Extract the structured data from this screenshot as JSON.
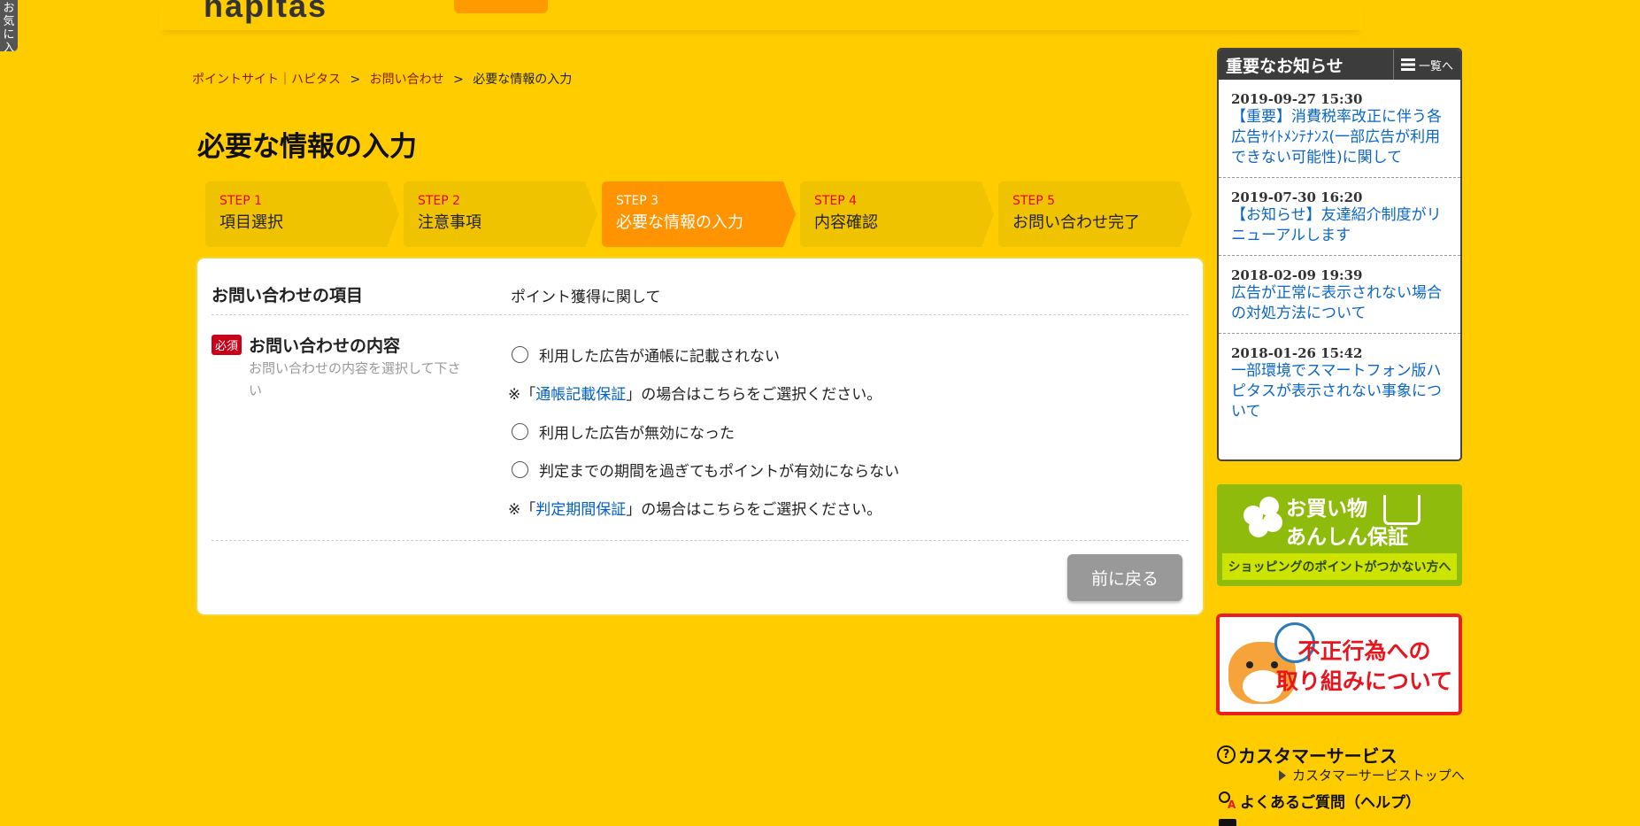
{
  "side_tab": {
    "label": "お気に入り"
  },
  "header": {
    "logo": "hapitas"
  },
  "breadcrumb": [
    {
      "label": "ポイントサイト｜ハピタス"
    },
    {
      "label": "お問い合わせ"
    },
    {
      "label": "必要な情報の入力"
    }
  ],
  "breadcrumb_sep": ">",
  "page_title": "必要な情報の入力",
  "steps": [
    {
      "num": "STEP 1",
      "label": "項目選択"
    },
    {
      "num": "STEP 2",
      "label": "注意事項"
    },
    {
      "num": "STEP 3",
      "label": "必要な情報の入力"
    },
    {
      "num": "STEP 4",
      "label": "内容確認"
    },
    {
      "num": "STEP 5",
      "label": "お問い合わせ完了"
    }
  ],
  "form": {
    "item_label": "お問い合わせの項目",
    "item_value": "ポイント獲得に関して",
    "required_badge": "必須",
    "content_label": "お問い合わせの内容",
    "content_help": "お問い合わせの内容を選択して下さい",
    "options": [
      "利用した広告が通帳に記載されない",
      "利用した広告が無効になった",
      "判定までの期間を過ぎてもポイントが有効にならない"
    ],
    "note1": {
      "prefix": "※「",
      "link": "通帳記載保証",
      "suffix": "」の場合はこちらをご選択ください。"
    },
    "note2": {
      "prefix": "※「",
      "link": "判定期間保証",
      "suffix": "」の場合はこちらをご選択ください。"
    },
    "back_button": "前に戻る"
  },
  "news": {
    "title": "重要なお知らせ",
    "more": "一覧へ",
    "items": [
      {
        "date": "2019-09-27 15:30",
        "text": "【重要】消費税率改正に伴う各広告ｻｲﾄﾒﾝﾃﾅﾝｽ(一部広告が利用できない可能性)に関して"
      },
      {
        "date": "2019-07-30 16:20",
        "text": "【お知らせ】友達紹介制度がリニューアルします"
      },
      {
        "date": "2018-02-09 19:39",
        "text": "広告が正常に表示されない場合の対処方法について"
      },
      {
        "date": "2018-01-26 15:42",
        "text": "一部環境でスマートフォン版ハピタスが表示されない事象について"
      }
    ]
  },
  "banner1": {
    "line1": "お買い物",
    "line2": "あんしん保証",
    "footer": "ショッピングのポイントがつかない方へ"
  },
  "banner2": {
    "line1": "不正行為への",
    "line2": "取り組みについて"
  },
  "customer_service": {
    "title": "カスタマーサービス",
    "top_link": "カスタマーサービストップへ",
    "faq": "よくあるご質問（ヘルプ）"
  },
  "colors": {
    "background": "#ffcc00",
    "step_active": "#ff9400",
    "step_inactive": "#f0c300",
    "step_number": "#e8002a",
    "link_blue": "#0a66c8",
    "required_red": "#c8001a",
    "back_button": "#999999",
    "banner_green": "#8fbc0c",
    "banner_red": "#e82020"
  },
  "icons": [
    "list-icon",
    "clover-icon",
    "cart-icon",
    "dog-mascot-icon",
    "clock-icon",
    "question-icon",
    "triangle-right-icon",
    "faq-search-icon"
  ]
}
